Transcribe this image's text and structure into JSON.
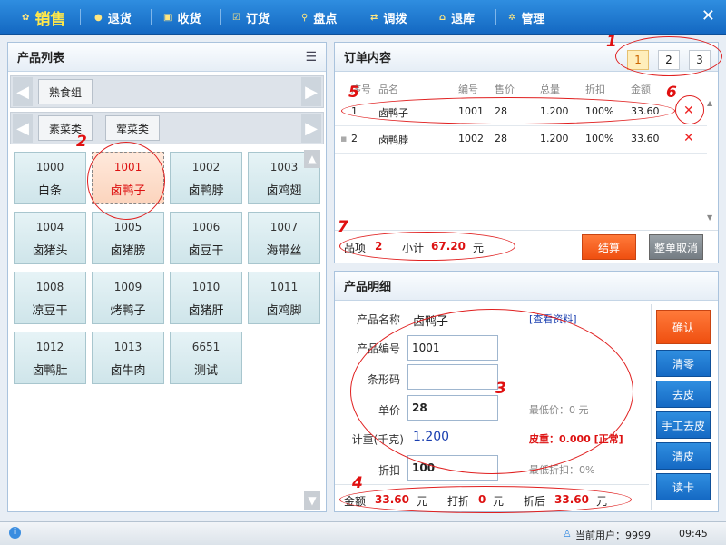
{
  "nav": {
    "items": [
      {
        "label": "销售",
        "active": true
      },
      {
        "label": "退货"
      },
      {
        "label": "收货"
      },
      {
        "label": "订货"
      },
      {
        "label": "盘点"
      },
      {
        "label": "调拨"
      },
      {
        "label": "退库"
      },
      {
        "label": "管理"
      }
    ],
    "close": "✕"
  },
  "product_list": {
    "title": "产品列表",
    "categories_row1": [
      "熟食组"
    ],
    "categories_row2": [
      "素菜类",
      "荤菜类"
    ],
    "products": [
      {
        "code": "1000",
        "name": "白条"
      },
      {
        "code": "1001",
        "name": "卤鸭子",
        "selected": true
      },
      {
        "code": "1002",
        "name": "卤鸭脖"
      },
      {
        "code": "1003",
        "name": "卤鸡翅"
      },
      {
        "code": "1004",
        "name": "卤猪头"
      },
      {
        "code": "1005",
        "name": "卤猪膀"
      },
      {
        "code": "1006",
        "name": "卤豆干"
      },
      {
        "code": "1007",
        "name": "海带丝"
      },
      {
        "code": "1008",
        "name": "凉豆干"
      },
      {
        "code": "1009",
        "name": "烤鸭子"
      },
      {
        "code": "1010",
        "name": "卤猪肝"
      },
      {
        "code": "1011",
        "name": "卤鸡脚"
      },
      {
        "code": "1012",
        "name": "卤鸭肚"
      },
      {
        "code": "1013",
        "name": "卤牛肉"
      },
      {
        "code": "6651",
        "name": "测试"
      }
    ]
  },
  "order": {
    "title": "订单内容",
    "pages": [
      "1",
      "2",
      "3"
    ],
    "columns": [
      "序号",
      "品名",
      "编号",
      "售价",
      "总量",
      "折扣",
      "金额"
    ],
    "rows": [
      {
        "no": "1",
        "name": "卤鸭子",
        "code": "1001",
        "price": "28",
        "qty": "1.200",
        "discount": "100%",
        "amount": "33.60"
      },
      {
        "no": "2",
        "name": "卤鸭脖",
        "code": "1002",
        "price": "28",
        "qty": "1.200",
        "discount": "100%",
        "amount": "33.60"
      }
    ],
    "items_label": "品项",
    "items_count": "2",
    "subtotal_label": "小计",
    "subtotal": "67.20",
    "currency": "元",
    "checkout": "结算",
    "cancel_all": "整单取消"
  },
  "detail": {
    "title": "产品明细",
    "name_label": "产品名称",
    "name_value": "卤鸭子",
    "view_link": "[查看资料]",
    "code_label": "产品编号",
    "code_value": "1001",
    "barcode_label": "条形码",
    "barcode_value": "",
    "price_label": "单价",
    "price_value": "28",
    "min_price": "最低价：0 元",
    "weight_label": "计重(千克)",
    "weight_value": "1.200",
    "tare": "皮重：0.000 [正常]",
    "discount_label": "折扣",
    "discount_value": "100",
    "min_discount": "最低折扣：0%",
    "amount_label": "金额",
    "amount_value": "33.60",
    "yuan": "元",
    "discount_off_label": "打折",
    "discount_off_value": "0",
    "after_label": "折后",
    "after_value": "33.60",
    "side_buttons": [
      "确认",
      "清零",
      "去皮",
      "手工去皮",
      "清皮",
      "读卡"
    ]
  },
  "status": {
    "info_icon": "i",
    "user_label": "当前用户：9999",
    "time": "09:45"
  },
  "annotations": [
    "1",
    "2",
    "3",
    "4",
    "5",
    "6",
    "7"
  ]
}
